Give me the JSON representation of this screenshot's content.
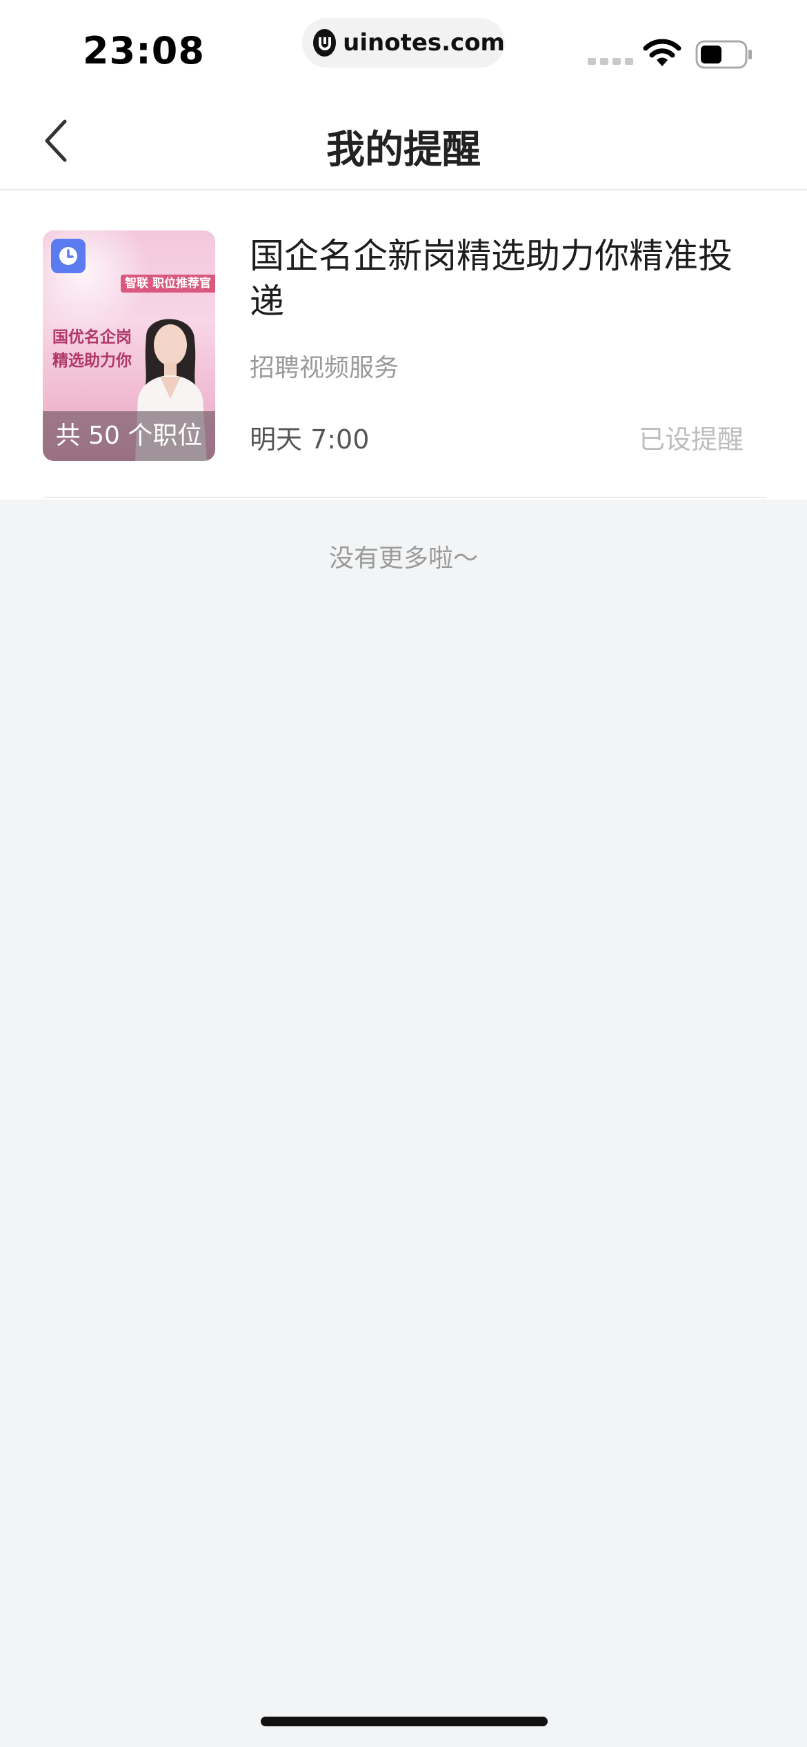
{
  "status_bar": {
    "time": "23:08",
    "url": "uinotes.com",
    "icons": [
      "signal-icon",
      "wifi-icon",
      "battery-icon"
    ]
  },
  "nav": {
    "title": "我的提醒",
    "back_icon": "chevron-left-icon"
  },
  "reminders": [
    {
      "thumbnail": {
        "badge": "智联 职位推荐官",
        "heading": "国优名企岗 精选助力你",
        "overlay": "共 50 个职位",
        "icon": "clock-icon"
      },
      "title": "国企名企新岗精选助力你精准投递",
      "subtitle": "招聘视频服务",
      "time": "明天 7:00",
      "status": "已设提醒"
    }
  ],
  "list_end_text": "没有更多啦～",
  "colors": {
    "accent_clock": "#5b7bf0",
    "badge": "#d9587e",
    "background": "#f3f4f6"
  }
}
